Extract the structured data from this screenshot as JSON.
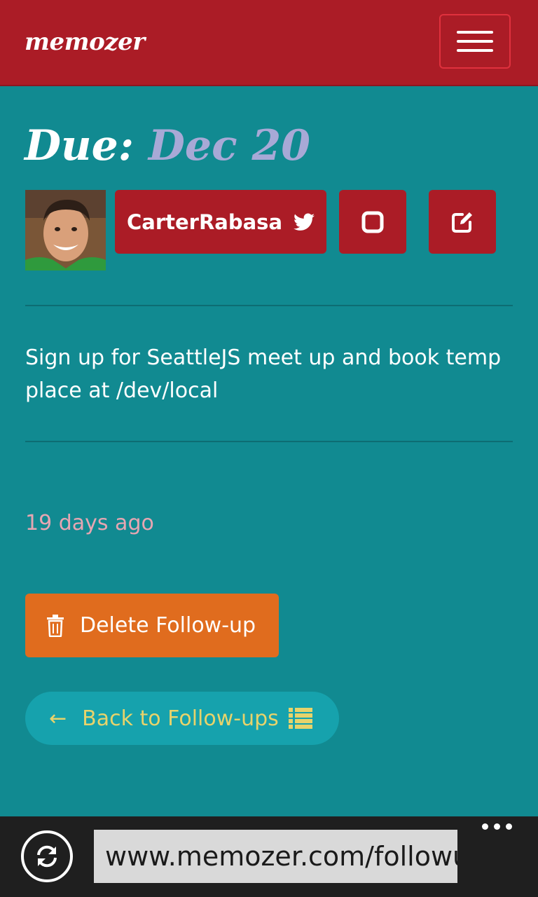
{
  "app": {
    "brand": "memozer"
  },
  "header": {
    "menu_icon": "hamburger-icon"
  },
  "followup": {
    "due_label": "Due:",
    "due_date": "Dec 20",
    "user_name": "CarterRabasa",
    "user_icon": "twitter-icon",
    "complete_icon": "square-icon",
    "edit_icon": "edit-icon",
    "description": "Sign up for SeattleJS meet up and book temp place at /dev/local",
    "age": "19 days ago"
  },
  "actions": {
    "delete_label": "Delete Follow-up",
    "delete_icon": "trash-icon",
    "back_arrow": "←",
    "back_label": "Back to Follow-ups",
    "back_icon": "list-icon"
  },
  "browser": {
    "url": "www.memozer.com/followup",
    "refresh_icon": "refresh-icon",
    "more_icon": "more-dots-icon"
  },
  "colors": {
    "navbar": "#ab1c26",
    "background": "#118a91",
    "due_date": "#a8a9d6",
    "delete_button": "#e06c1e",
    "back_button": "#16a2ad",
    "back_text": "#e7d36b",
    "age_text": "#e6a6b2"
  }
}
